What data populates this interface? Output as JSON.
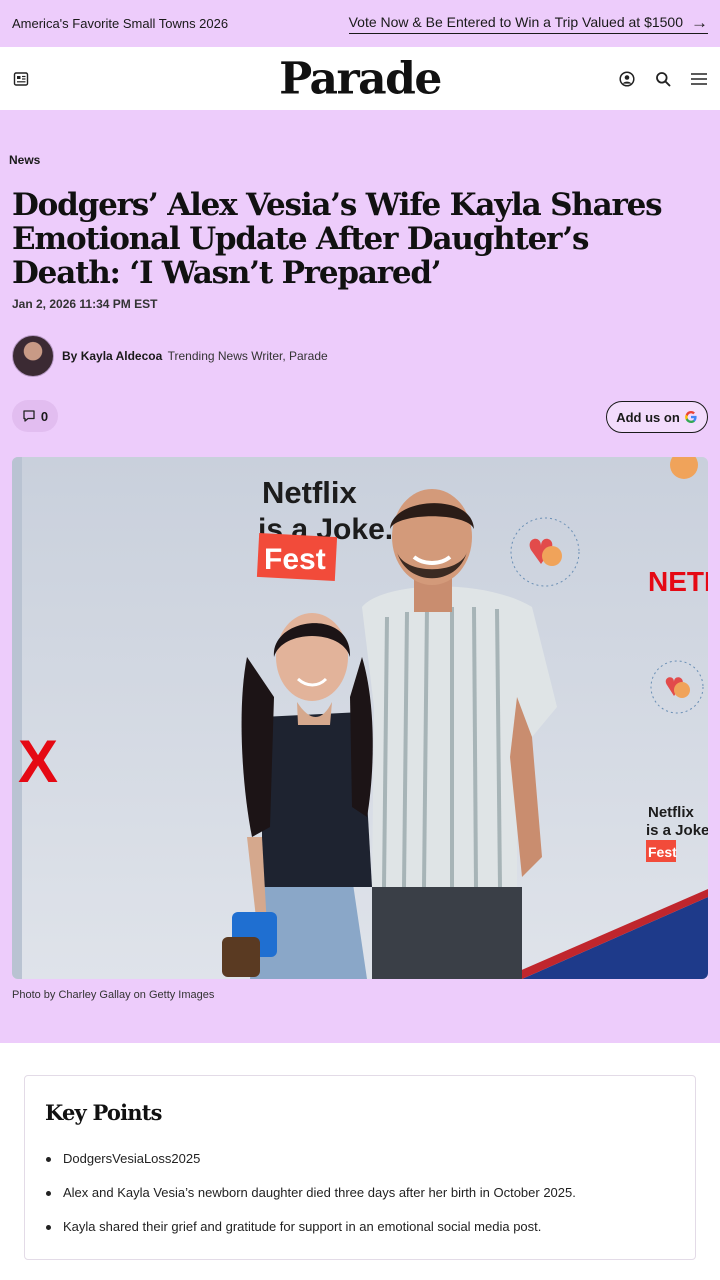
{
  "promo": {
    "left_text": "America's Favorite Small Towns 2026",
    "right_text": "Vote Now & Be Entered to Win a Trip Valued at $1500",
    "arrow_icon": "arrow-right-icon"
  },
  "header": {
    "logo": "Parade",
    "icons": [
      "newspaper-icon",
      "user-icon",
      "search-icon",
      "menu-icon"
    ]
  },
  "article": {
    "category": "News",
    "headline": "Dodgers’ Alex Vesia’s Wife Kayla Shares Emotional Update After Daughter’s Death: ‘I Wasn’t Prepared’",
    "date": "Jan 2, 2026 11:34 PM EST",
    "author_prefix": "By",
    "author_name": "Kayla Aldecoa",
    "author_role": "Trending News Writer, Parade",
    "comment_count": "0",
    "add_us_label": "Add us on",
    "photo_credit": "Photo by Charley Gallay on Getty Images",
    "photo_backdrop_text": {
      "event_line1": "Netflix",
      "event_line2": "is a Joke.",
      "event_line3": "Fest",
      "sponsor": "NETFLIX"
    }
  },
  "key_points": {
    "title": "Key Points",
    "items": [
      "DodgersVesiaLoss2025",
      "Alex and Kayla Vesia’s newborn daughter died three days after her birth in October 2025.",
      "Kayla shared their grief and gratitude for support in an emotional social media post."
    ]
  },
  "colors": {
    "hero_bg": "#edccfb",
    "netflix_red": "#e50914",
    "fest_orange": "#f24b3a"
  }
}
